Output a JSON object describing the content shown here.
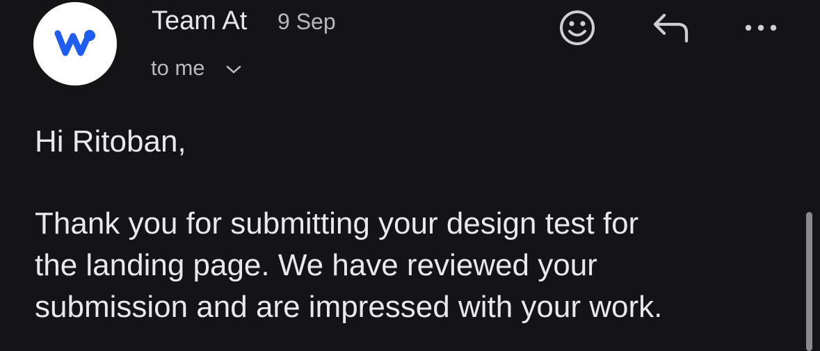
{
  "header": {
    "sender_name": "Team At",
    "date": "9 Sep",
    "recipient_label": "to me",
    "avatar_icon": "brand-w-logo-icon",
    "avatar_logo_color": "#1f5cf0"
  },
  "actions": [
    {
      "name": "emoji-reaction",
      "icon": "smiley-icon"
    },
    {
      "name": "reply",
      "icon": "reply-arrow-icon"
    },
    {
      "name": "more",
      "icon": "more-horizontal-icon"
    }
  ],
  "body": {
    "greeting": "Hi Ritoban,",
    "paragraph_lines": [
      "Thank you for submitting your design test for",
      "the landing page. We have reviewed your",
      "submission and are impressed with your work."
    ]
  },
  "colors": {
    "background": "#141416",
    "text": "#e9e9eb",
    "muted_text": "#b9b9bd",
    "accent_blue": "#1f5cf0"
  }
}
